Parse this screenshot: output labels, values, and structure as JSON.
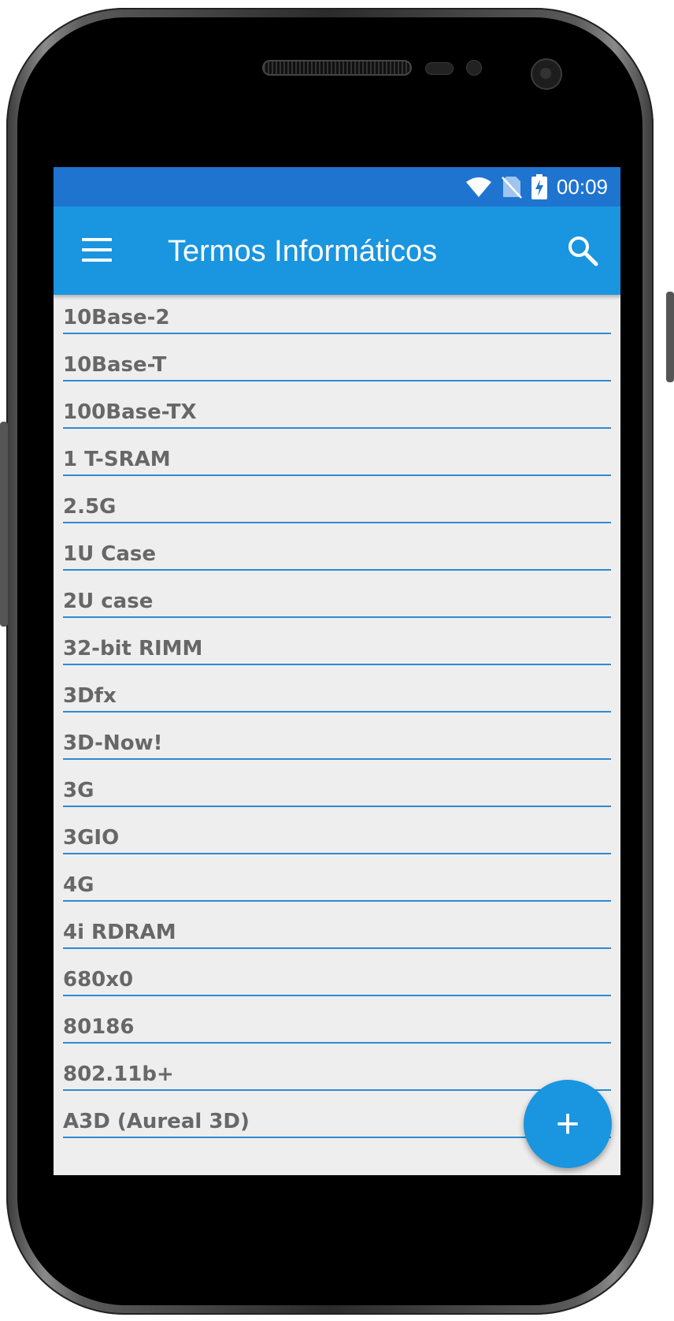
{
  "status_bar": {
    "time": "00:09",
    "icons": [
      "wifi-icon",
      "no-sim-icon",
      "battery-charging-icon"
    ]
  },
  "app_bar": {
    "title": "Termos Informáticos",
    "menu_icon": "hamburger-menu-icon",
    "search_icon": "search-icon"
  },
  "terms": [
    "10Base-2",
    "10Base-T",
    "100Base-TX",
    "1 T-SRAM",
    "2.5G",
    "1U Case",
    "2U case",
    "32-bit RIMM",
    "3Dfx",
    "3D-Now!",
    "3G",
    "3GIO",
    "4G",
    "4i RDRAM",
    "680x0",
    "80186",
    "802.11b+",
    "A3D (Aureal 3D)"
  ],
  "fab": {
    "label": "+",
    "icon": "add-icon"
  },
  "colors": {
    "status_bar": "#1f74d0",
    "app_bar": "#1a95df",
    "divider": "#2e8ad3",
    "list_bg": "#eeeeee",
    "item_text": "#676767"
  }
}
